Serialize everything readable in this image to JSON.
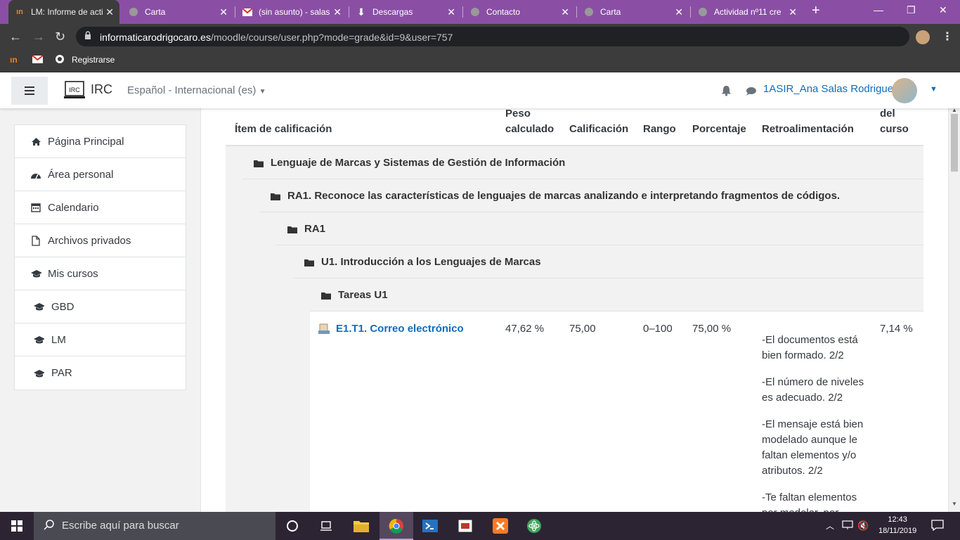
{
  "browser": {
    "tabs": [
      {
        "title": "LM: Informe de acti",
        "icon": "moodle-icon",
        "active": true
      },
      {
        "title": "Carta",
        "icon": "globe-icon"
      },
      {
        "title": "(sin asunto) - salas",
        "icon": "gmail-icon"
      },
      {
        "title": "Descargas",
        "icon": "download-icon"
      },
      {
        "title": "Contacto",
        "icon": "globe-icon"
      },
      {
        "title": "Carta",
        "icon": "globe-icon"
      },
      {
        "title": "Actividad nº11 cre",
        "icon": "globe-icon"
      }
    ],
    "url_domain": "informaticarodrigocaro.es",
    "url_path": "/moodle/course/user.php?mode=grade&id=9&user=757",
    "bookmarks": [
      {
        "label": "",
        "icon": "moodle-icon"
      },
      {
        "label": "",
        "icon": "gmail-icon"
      },
      {
        "label": "Registrarse",
        "icon": "globe-icon"
      }
    ]
  },
  "navbar": {
    "brand": "IRC",
    "logo_text": "IRC",
    "language": "Español - Internacional (es)",
    "user_name": "1ASIR_Ana Salas Rodriguez"
  },
  "sidebar": {
    "items": [
      {
        "label": "Página Principal",
        "icon": "home-icon"
      },
      {
        "label": "Área personal",
        "icon": "dashboard-icon"
      },
      {
        "label": "Calendario",
        "icon": "calendar-icon"
      },
      {
        "label": "Archivos privados",
        "icon": "file-icon"
      },
      {
        "label": "Mis cursos",
        "icon": "graduation-cap-icon"
      },
      {
        "label": "GBD",
        "icon": "graduation-cap-icon"
      },
      {
        "label": "LM",
        "icon": "graduation-cap-icon"
      },
      {
        "label": "PAR",
        "icon": "graduation-cap-icon"
      }
    ]
  },
  "grades_table": {
    "headers": {
      "item": "Ítem de calificación",
      "weight_1": "Peso",
      "weight_2": "calculado",
      "grade": "Calificación",
      "range": "Rango",
      "percentage": "Porcentaje",
      "feedback": "Retroalimentación",
      "course_1": "del",
      "course_2": "curso"
    },
    "categories": [
      "Lenguaje de Marcas y Sistemas de Gestión de Información",
      "RA1. Reconoce las características de lenguajes de marcas analizando e interpretando fragmentos de códigos.",
      "RA1",
      "U1. Introducción a los Lenguajes de Marcas",
      "Tareas U1"
    ],
    "item": {
      "name": "E1.T1. Correo electrónico",
      "weight": "47,62 %",
      "grade": "75,00",
      "range": "0–100",
      "percentage": "75,00 %",
      "contribution": "7,14 %",
      "feedback": [
        "-El documentos está bien formado. 2/2",
        "-El número de niveles es adecuado. 2/2",
        "-El mensaje está bien modelado aunque le faltan elementos y/o atributos. 2/2",
        "-Te faltan elementos por modelar, por"
      ]
    }
  },
  "taskbar": {
    "search_placeholder": "Escribe aquí para buscar",
    "time": "12:43",
    "date": "18/11/2019"
  }
}
